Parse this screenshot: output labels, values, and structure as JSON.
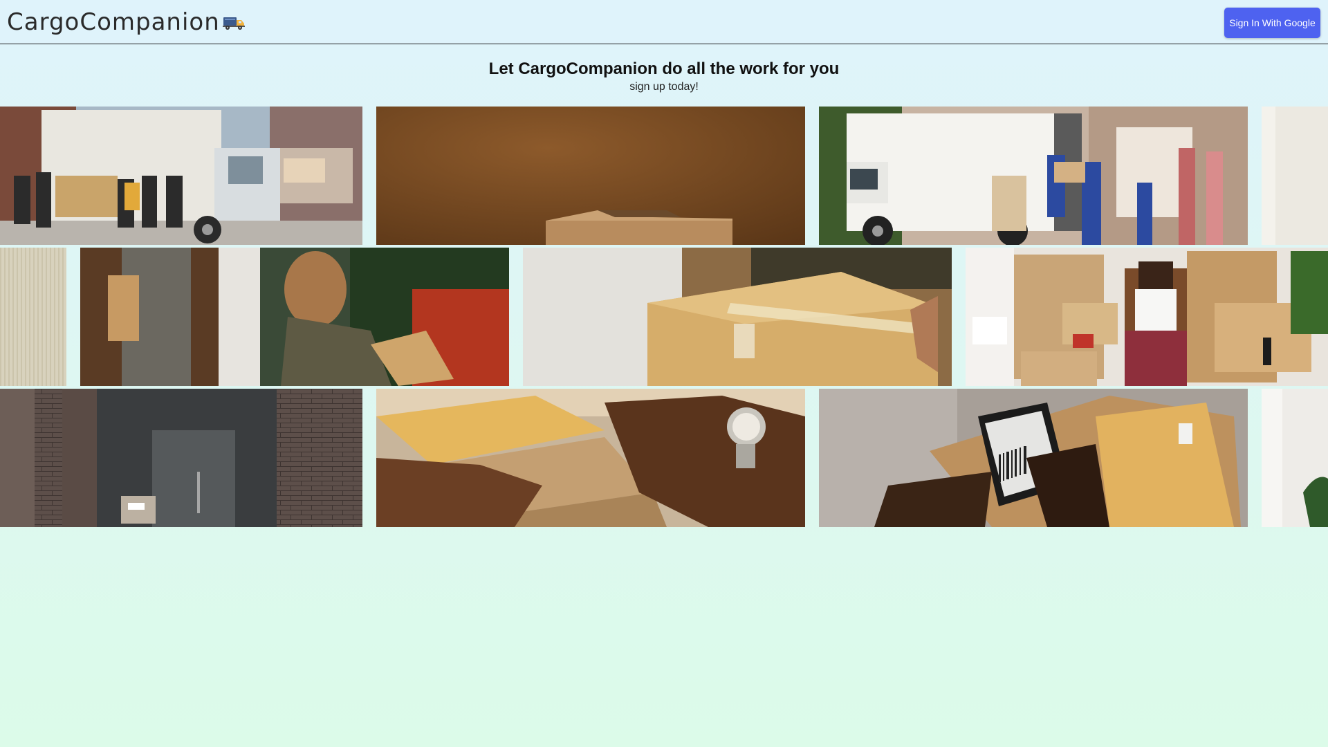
{
  "header": {
    "brand": "CargoCompanion",
    "brand_icon": "delivery-truck-icon",
    "signin_label": "Sign In With Google"
  },
  "hero": {
    "title": "Let CargoCompanion do all the work for you",
    "subtitle": "sign up today!"
  },
  "gallery": {
    "rows": [
      [
        "movers-crew-with-truck-photo",
        "cardboard-box-on-table-photo",
        "movers-loading-truck-photo",
        "white-wall-photo"
      ],
      [
        "corrugated-cardboard-photo",
        "woman-loading-box-into-car-photo",
        "taping-cardboard-box-photo",
        "woman-sitting-among-boxes-photo"
      ],
      [
        "package-at-brick-door-photo",
        "handing-over-package-photo",
        "scanning-package-barcode-photo",
        "white-room-with-plant-photo"
      ]
    ]
  },
  "colors": {
    "accent": "#4e62f0",
    "header_bg": "#dff3fb",
    "page_bottom": "#dcfbe9"
  }
}
